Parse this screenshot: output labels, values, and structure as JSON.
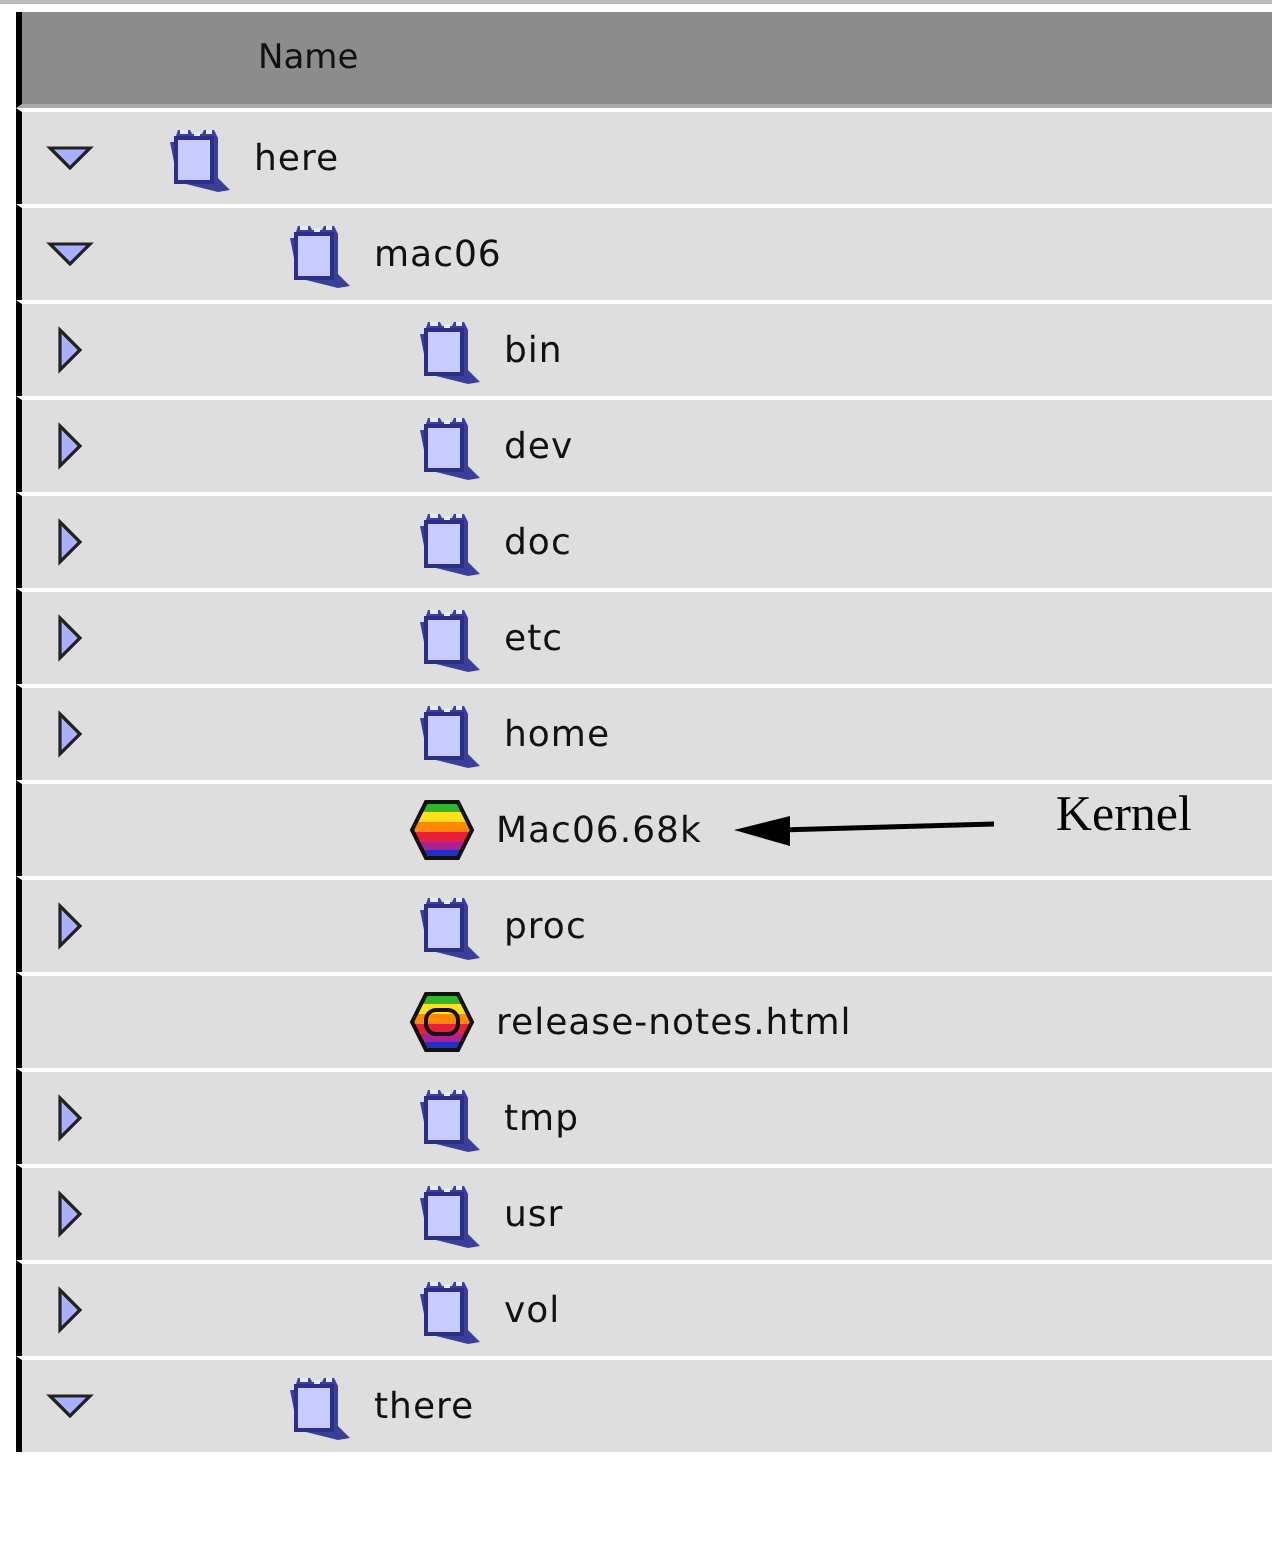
{
  "header": {
    "column": "Name"
  },
  "tree": [
    {
      "name": "here",
      "kind": "folder",
      "expanded": true,
      "children": [
        {
          "name": "mac06",
          "kind": "folder",
          "expanded": true,
          "children": [
            {
              "name": "bin",
              "kind": "folder",
              "expanded": false
            },
            {
              "name": "dev",
              "kind": "folder",
              "expanded": false
            },
            {
              "name": "doc",
              "kind": "folder",
              "expanded": false
            },
            {
              "name": "etc",
              "kind": "folder",
              "expanded": false
            },
            {
              "name": "home",
              "kind": "folder",
              "expanded": false
            },
            {
              "name": "Mac06.68k",
              "kind": "application",
              "annotation": "Kernel"
            },
            {
              "name": "proc",
              "kind": "folder",
              "expanded": false
            },
            {
              "name": "release-notes.html",
              "kind": "document"
            },
            {
              "name": "tmp",
              "kind": "folder",
              "expanded": false
            },
            {
              "name": "usr",
              "kind": "folder",
              "expanded": false
            },
            {
              "name": "vol",
              "kind": "folder",
              "expanded": false
            }
          ]
        },
        {
          "name": "there",
          "kind": "folder",
          "expanded": true
        }
      ]
    }
  ]
}
